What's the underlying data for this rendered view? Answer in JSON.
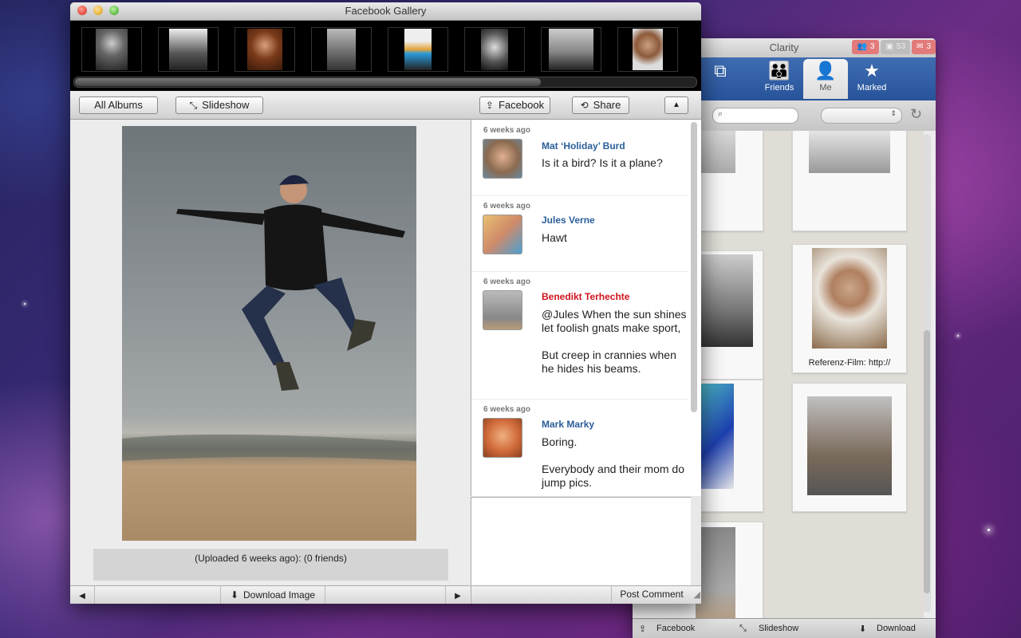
{
  "gallery": {
    "title": "Facebook Gallery",
    "toolbar": {
      "all_albums": "All Albums",
      "slideshow": "Slideshow",
      "facebook": "Facebook",
      "share": "Share",
      "collapse": "▲"
    },
    "caption": "(Uploaded 6 weeks ago):  (0 friends)",
    "nav": {
      "prev": "◀",
      "download": "Download Image",
      "next": "▶"
    },
    "comments": [
      {
        "time": "6 weeks ago",
        "name": "Mat ‘Holiday’ Burd",
        "text": "Is it a bird? Is it a plane?"
      },
      {
        "time": "6 weeks ago",
        "name": "Jules Verne",
        "text": "Hawt"
      },
      {
        "time": "6 weeks ago",
        "name": "Benedikt Terhechte",
        "text": "@Jules When the sun shines let foolish gnats make sport,\n\nBut creep in crannies when he hides his beams."
      },
      {
        "time": "6 weeks ago",
        "name": "Mark Marky",
        "text": "Boring.\n\nEverybody and their mom do jump pics."
      }
    ],
    "post_comment": "Post Comment",
    "colors": {
      "link_name": "#2a5e99",
      "highlight_name": "#d0121b"
    }
  },
  "clarity": {
    "title": "Clarity",
    "badges": [
      {
        "icon": "friends-icon",
        "count": "3"
      },
      {
        "icon": "photos-icon",
        "count": "53"
      },
      {
        "icon": "comment-icon",
        "count": "3"
      }
    ],
    "tabs": {
      "friends": "Friends",
      "me": "Me",
      "marked": "Marked"
    },
    "tile_caption": "Referenz-Film:  http://",
    "bottom": {
      "facebook": "Facebook",
      "slideshow": "Slideshow",
      "download": "Download"
    }
  }
}
